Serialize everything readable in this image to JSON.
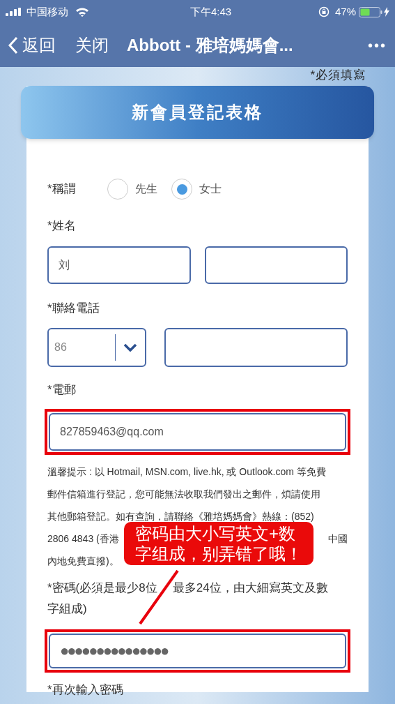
{
  "status_bar": {
    "carrier": "中国移动",
    "time": "下午4:43",
    "battery": "47%"
  },
  "nav": {
    "back": "返回",
    "close": "关闭",
    "title": "Abbott - 雅培媽媽會...",
    "more": "•••"
  },
  "required_note": "*必須填寫",
  "form_title": "新會員登記表格",
  "salutation": {
    "label": "*稱謂",
    "options": [
      {
        "label": "先生",
        "selected": false
      },
      {
        "label": "女士",
        "selected": true
      }
    ]
  },
  "name": {
    "label": "*姓名",
    "fields": [
      {
        "kind": "text",
        "value": "刘"
      },
      {
        "kind": "text"
      }
    ]
  },
  "phone": {
    "label": "*聯絡電話",
    "code": "86"
  },
  "email": {
    "label": "*電郵",
    "value": "827859463@qq.com",
    "highlighted": true
  },
  "notice_lines": [
    [
      "溫馨提示 : 以 Hotmail, MSN.com, live.hk, 或 Outlook.com 等免費"
    ],
    [
      "郵件信箱進行登記，您可能無法收取我們發出之郵件，煩請使用"
    ],
    [
      "其他郵箱登記。如有查詢，請聯絡《雅培媽媽會》熱線：(852)"
    ],
    [
      "2806 4843 (香港",
      "中國"
    ],
    [
      "內地免費直撥)。"
    ]
  ],
  "password": {
    "label_parts": [
      "*密碼(必須是最少8位",
      "最多24位，由大細寫英文及數",
      "字組成)"
    ],
    "value": "●●●●●●●●●●●●●●●",
    "highlighted": true
  },
  "confirm_password": {
    "label": "*再次輸入密碼"
  },
  "callout": {
    "text": "密码由大小写英文+数字组成，别弄错了哦！"
  }
}
